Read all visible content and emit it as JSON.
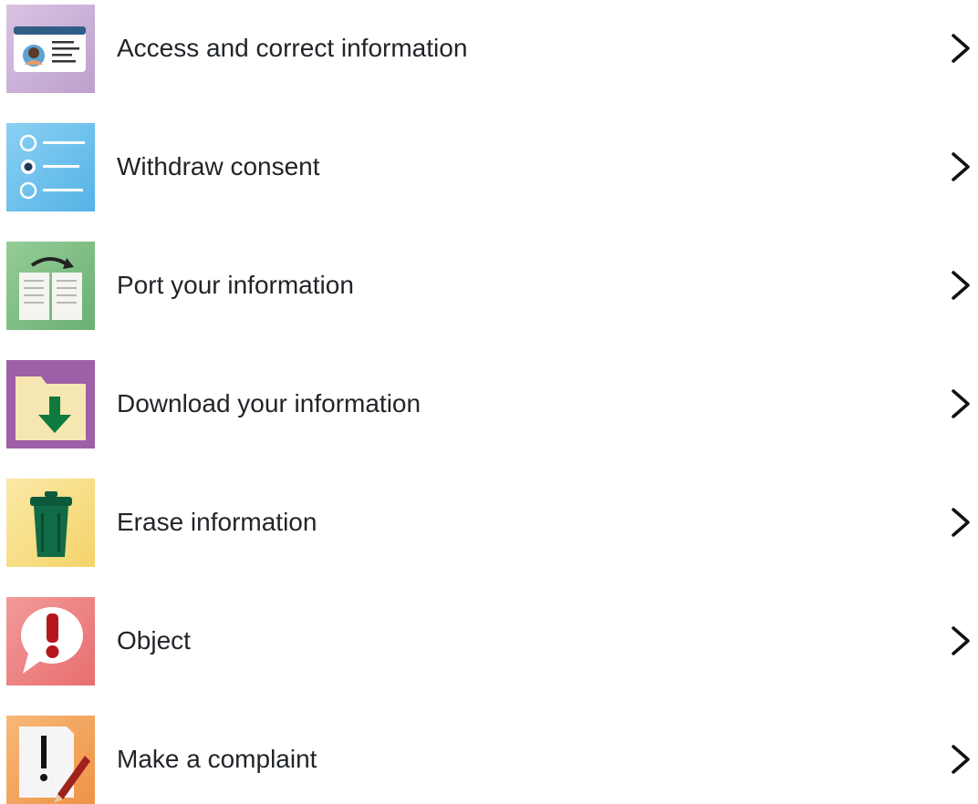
{
  "items": [
    {
      "label": "Access and correct information",
      "icon": "id-card-icon",
      "tile_color": "#c9aed6"
    },
    {
      "label": "Withdraw consent",
      "icon": "radio-options-icon",
      "tile_color": "#6fc0ea"
    },
    {
      "label": "Port your information",
      "icon": "transfer-book-icon",
      "tile_color": "#7fbf84"
    },
    {
      "label": "Download your information",
      "icon": "download-folder-icon",
      "tile_color": "#9d5fa6"
    },
    {
      "label": "Erase information",
      "icon": "trash-bin-icon",
      "tile_color": "#f7dc7e"
    },
    {
      "label": "Object",
      "icon": "exclamation-bubble-icon",
      "tile_color": "#ee7f7f"
    },
    {
      "label": "Make a complaint",
      "icon": "complaint-document-icon",
      "tile_color": "#f2a45f"
    }
  ],
  "chevron_icon": "chevron-right-icon"
}
